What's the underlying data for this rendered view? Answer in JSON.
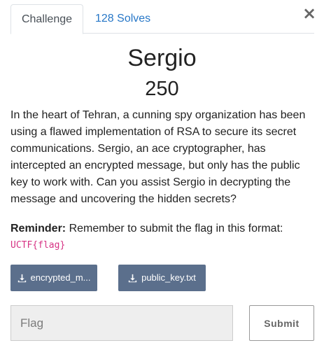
{
  "tabs": [
    {
      "label": "Challenge",
      "active": true
    },
    {
      "label": "128 Solves",
      "active": false
    }
  ],
  "close_icon": "close-icon",
  "challenge": {
    "name": "Sergio",
    "points": "250",
    "description": "In the heart of Tehran, a cunning spy organization has been using a flawed implementation of RSA to secure its secret communications. Sergio, an ace cryptographer, has intercepted an encrypted message, but only has the public key to work with. Can you assist Sergio in decrypting the message and uncovering the hidden secrets?",
    "reminder_label": "Reminder:",
    "reminder_text": " Remember to submit the flag in this format:",
    "flag_format": "UCTF{flag}"
  },
  "files": [
    {
      "label": "encrypted_m...",
      "icon": "download-icon"
    },
    {
      "label": "public_key.txt",
      "icon": "download-icon"
    }
  ],
  "submission": {
    "placeholder": "Flag",
    "value": "",
    "submit_label": "Submit"
  },
  "colors": {
    "tab_link": "#2777c7",
    "file_button": "#5b6f8c",
    "code": "#d63384"
  }
}
